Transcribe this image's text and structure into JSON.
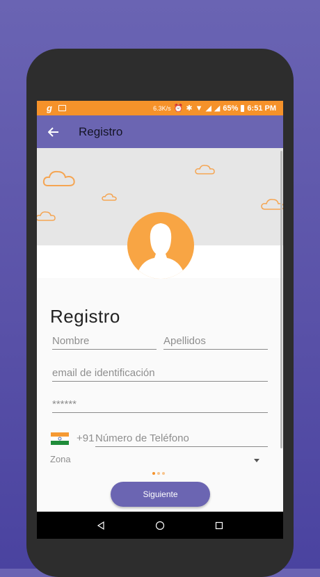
{
  "status_bar": {
    "carrier_glyph": "g",
    "speed": "6.3K/s",
    "battery": "65%",
    "time": "6:51 PM",
    "icons": [
      "gallery-icon",
      "alarm-icon",
      "bluetooth-icon",
      "wifi-icon",
      "signal-icon",
      "signal-icon",
      "battery-icon"
    ]
  },
  "app_bar": {
    "title": "Registro",
    "back_icon": "arrow-back-icon"
  },
  "form": {
    "heading": "Registro",
    "first_name_placeholder": "Nombre",
    "last_name_placeholder": "Apellidos",
    "email_placeholder": "email de identificación",
    "password_placeholder": "******",
    "phone_prefix": "+91",
    "phone_placeholder": "Número de Teléfono",
    "zone_label": "Zona"
  },
  "pager": {
    "total": 3,
    "active": 1
  },
  "next_button": {
    "label": "Siguiente"
  },
  "colors": {
    "accent": "#6b65b2",
    "orange": "#f5922a",
    "avatar": "#f8a544",
    "background": "#5a52a8"
  }
}
